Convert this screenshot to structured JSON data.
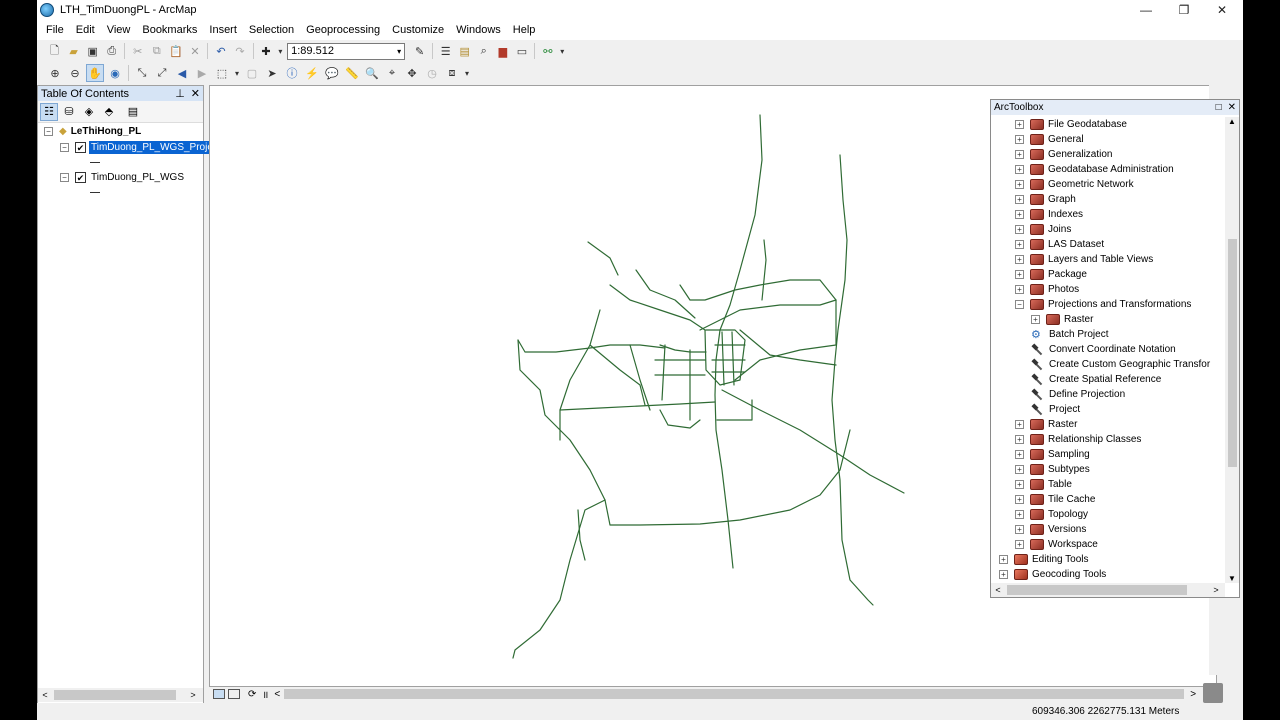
{
  "window": {
    "title": "LTH_TimDuongPL - ArcMap"
  },
  "menu": [
    "File",
    "Edit",
    "View",
    "Bookmarks",
    "Insert",
    "Selection",
    "Geoprocessing",
    "Customize",
    "Windows",
    "Help"
  ],
  "standard_toolbar": {
    "scale": "1:89.512"
  },
  "toc": {
    "title": "Table Of Contents",
    "group": "LeThiHong_PL",
    "layers": [
      {
        "name": "TimDuong_PL_WGS_Proje",
        "checked": "✔",
        "selected": true
      },
      {
        "name": "TimDuong_PL_WGS",
        "checked": "✔",
        "selected": false
      }
    ]
  },
  "toolbox": {
    "title": "ArcToolbox",
    "items": [
      {
        "label": "File Geodatabase",
        "kind": "toolset",
        "exp": "+"
      },
      {
        "label": "General",
        "kind": "toolset",
        "exp": "+"
      },
      {
        "label": "Generalization",
        "kind": "toolset",
        "exp": "+"
      },
      {
        "label": "Geodatabase Administration",
        "kind": "toolset",
        "exp": "+"
      },
      {
        "label": "Geometric Network",
        "kind": "toolset",
        "exp": "+"
      },
      {
        "label": "Graph",
        "kind": "toolset",
        "exp": "+"
      },
      {
        "label": "Indexes",
        "kind": "toolset",
        "exp": "+"
      },
      {
        "label": "Joins",
        "kind": "toolset",
        "exp": "+"
      },
      {
        "label": "LAS Dataset",
        "kind": "toolset",
        "exp": "+"
      },
      {
        "label": "Layers and Table Views",
        "kind": "toolset",
        "exp": "+"
      },
      {
        "label": "Package",
        "kind": "toolset",
        "exp": "+"
      },
      {
        "label": "Photos",
        "kind": "toolset",
        "exp": "+"
      },
      {
        "label": "Projections and Transformations",
        "kind": "toolset",
        "exp": "−"
      },
      {
        "label": "Raster",
        "kind": "subtoolset",
        "exp": "+"
      },
      {
        "label": "Batch Project",
        "kind": "script"
      },
      {
        "label": "Convert Coordinate Notation",
        "kind": "tool"
      },
      {
        "label": "Create Custom Geographic Transfor",
        "kind": "tool"
      },
      {
        "label": "Create Spatial Reference",
        "kind": "tool"
      },
      {
        "label": "Define Projection",
        "kind": "tool"
      },
      {
        "label": "Project",
        "kind": "tool"
      },
      {
        "label": "Raster",
        "kind": "toolset",
        "exp": "+"
      },
      {
        "label": "Relationship Classes",
        "kind": "toolset",
        "exp": "+"
      },
      {
        "label": "Sampling",
        "kind": "toolset",
        "exp": "+"
      },
      {
        "label": "Subtypes",
        "kind": "toolset",
        "exp": "+"
      },
      {
        "label": "Table",
        "kind": "toolset",
        "exp": "+"
      },
      {
        "label": "Tile Cache",
        "kind": "toolset",
        "exp": "+"
      },
      {
        "label": "Topology",
        "kind": "toolset",
        "exp": "+"
      },
      {
        "label": "Versions",
        "kind": "toolset",
        "exp": "+"
      },
      {
        "label": "Workspace",
        "kind": "toolset",
        "exp": "+"
      },
      {
        "label": "Editing Tools",
        "kind": "toolbox",
        "exp": "+"
      },
      {
        "label": "Geocoding Tools",
        "kind": "toolbox",
        "exp": "+"
      }
    ]
  },
  "status": {
    "coordinates": "609346.306  2262775.131 Meters"
  },
  "colors": {
    "road": "#2f6b34",
    "selection": "#0a64d2",
    "toc_header": "#d6e4f5"
  }
}
